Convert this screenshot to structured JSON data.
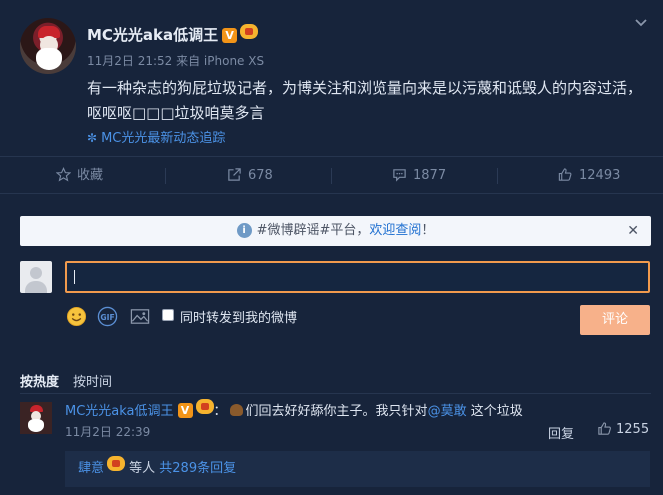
{
  "post": {
    "username": "MC光光aka低调王",
    "verified_badge": "V",
    "meta": "11月2日 21:52 来自 iPhone XS",
    "text": "有一种杂志的狗屁垃圾记者，为博关注和浏览量向来是以污蔑和诋毁人的内容过活，呕呕呕□□□垃圾咱莫多言",
    "follow_link": "MC光光最新动态追踪"
  },
  "actions": {
    "favorite": "收藏",
    "repost": "678",
    "comment": "1877",
    "like": "12493"
  },
  "notice": {
    "prefix": "#微博辟谣#平台，",
    "highlight": "欢迎查阅",
    "suffix": "！",
    "close": "✕"
  },
  "composer": {
    "repost_label": "同时转发到我的微博",
    "submit_label": "评论"
  },
  "sort": {
    "hot": "按热度",
    "time": "按时间"
  },
  "comment": {
    "username": "MC光光aka低调王",
    "verified_badge": "V",
    "colon": "：",
    "text_before": "们回去好好舔你主子。我只针对",
    "mention": "@莫敢",
    "text_after": " 这个垃圾",
    "time": "11月2日 22:39",
    "reply_label": "回复",
    "likes": "1255"
  },
  "sub_replies": {
    "user": "肆意",
    "middle": " 等人 ",
    "link": "共289条回复"
  },
  "colors": {
    "background": "#17243b",
    "link": "#4b92e6",
    "accent_orange": "#f19a4d",
    "submit_button": "#f7b18a"
  },
  "icons": [
    "chevron-down-icon",
    "star-icon",
    "share-icon",
    "comment-icon",
    "thumb-up-icon",
    "info-icon",
    "emoji-icon",
    "gif-icon",
    "image-icon"
  ]
}
